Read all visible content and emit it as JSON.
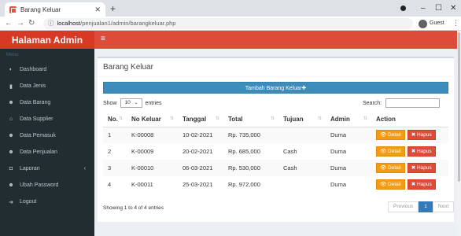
{
  "browser": {
    "tab_title": "Barang Keluar",
    "tab_close": "✕",
    "new_tab": "+",
    "url_host": "localhost",
    "url_path": "/penjualan1/admin/barangkeluar.php",
    "profile": "Guest",
    "minimize": "–",
    "maximize": "☐",
    "close": "✕"
  },
  "sidebar": {
    "brand": "Halaman Admin",
    "menu_header": "Menu",
    "items": [
      {
        "label": "Dashboard",
        "icon": "dashboard-icon",
        "glyph": "◐"
      },
      {
        "label": "Data Jenis",
        "icon": "book-icon",
        "glyph": "▮"
      },
      {
        "label": "Data Barang",
        "icon": "users-icon",
        "glyph": "☻"
      },
      {
        "label": "Data Supplier",
        "icon": "bank-icon",
        "glyph": "⌂"
      },
      {
        "label": "Data Pemasuk",
        "icon": "users-icon",
        "glyph": "☻"
      },
      {
        "label": "Data Penjualan",
        "icon": "users-icon",
        "glyph": "☻"
      },
      {
        "label": "Laporan",
        "icon": "camera-icon",
        "glyph": "◘",
        "caret": "‹"
      },
      {
        "label": "Ubah Password",
        "icon": "users-icon",
        "glyph": "☻"
      },
      {
        "label": "Logout",
        "icon": "logout-icon",
        "glyph": "➜"
      }
    ]
  },
  "main": {
    "title": "Barang Keluar",
    "add_button": "Tambah Barang Keluar✚",
    "show_label": "Show",
    "entries_value": "10",
    "entries_label": "entries",
    "search_label": "Search:",
    "columns": [
      "No.",
      "No Keluar",
      "Tanggal",
      "Total",
      "Tujuan",
      "Admin",
      "Action"
    ],
    "rows": [
      {
        "no": "1",
        "no_keluar": "K-00008",
        "tanggal": "10-02-2021",
        "total": "Rp. 735,000",
        "tujuan": "",
        "admin": "Duma"
      },
      {
        "no": "2",
        "no_keluar": "K-00009",
        "tanggal": "20-02-2021",
        "total": "Rp. 685,000",
        "tujuan": "Cash",
        "admin": "Duma"
      },
      {
        "no": "3",
        "no_keluar": "K-00010",
        "tanggal": "06-03-2021",
        "total": "Rp. 530,000",
        "tujuan": "Cash",
        "admin": "Duma"
      },
      {
        "no": "4",
        "no_keluar": "K-00011",
        "tanggal": "25-03-2021",
        "total": "Rp. 972,000",
        "tujuan": "",
        "admin": "Duma"
      }
    ],
    "detail_label": "👁 Detail",
    "hapus_label": "✖ Hapus",
    "info": "Showing 1 to 4 of 4 entries",
    "pager": {
      "previous": "Previous",
      "page": "1",
      "next": "Next"
    }
  }
}
